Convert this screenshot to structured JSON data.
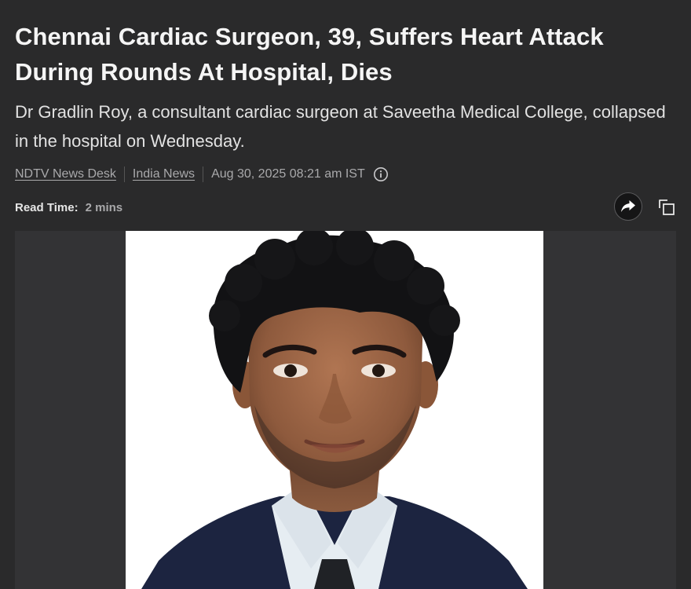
{
  "article": {
    "headline": "Chennai Cardiac Surgeon, 39, Suffers Heart Attack During Rounds At Hospital, Dies",
    "summary": "Dr Gradlin Roy, a consultant cardiac surgeon at Saveetha Medical College, collapsed in the hospital on Wednesday.",
    "byline": {
      "author": "NDTV News Desk",
      "category": "India News",
      "timestamp": "Aug 30, 2025 08:21 am IST"
    },
    "read_time": {
      "label": "Read Time:",
      "value": "2 mins"
    }
  },
  "icons": {
    "info": "info-icon",
    "share": "share-arrow-icon",
    "copy": "copy-icon"
  },
  "colors": {
    "background": "#2a2a2b",
    "headline": "#f5f5f5",
    "muted": "#a9a9ab",
    "photo_background": "#ffffff",
    "suit": "#1c2440"
  }
}
